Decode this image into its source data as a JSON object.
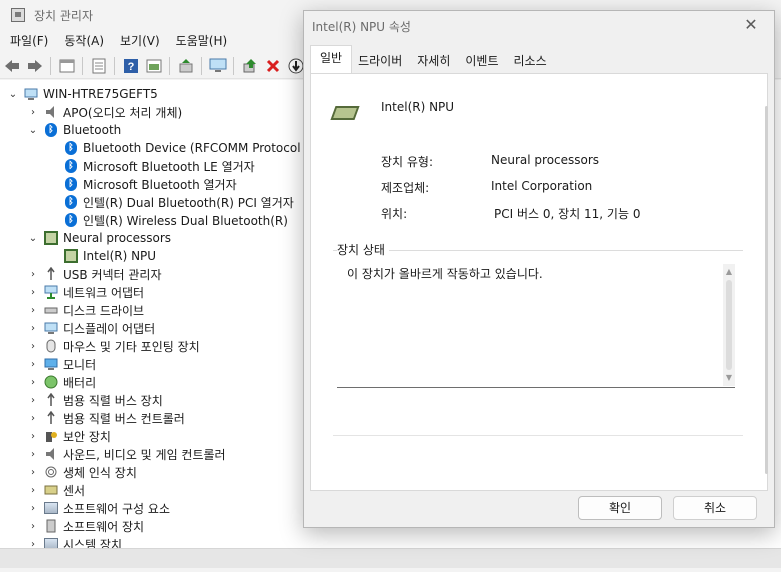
{
  "main_window": {
    "title": "장치 관리자",
    "menu": [
      "파일(F)",
      "동작(A)",
      "보기(V)",
      "도움말(H)"
    ],
    "toolbar_icons": [
      "back-icon",
      "forward-icon",
      "properties-icon",
      "list-icon",
      "help-icon",
      "console-icon",
      "update-driver-icon",
      "monitor-icon",
      "enable-device-icon",
      "uninstall-icon",
      "download-icon"
    ]
  },
  "tree": {
    "root": "WIN-HTRE75GEFT5",
    "nodes": [
      {
        "label": "APO(오디오 처리 개체)",
        "expanded": false
      },
      {
        "label": "Bluetooth",
        "expanded": true
      },
      {
        "label": "Bluetooth Device (RFCOMM Protocol TDI)",
        "child": true
      },
      {
        "label": "Microsoft Bluetooth LE 열거자",
        "child": true
      },
      {
        "label": "Microsoft Bluetooth 열거자",
        "child": true
      },
      {
        "label": "인텔(R) Dual Bluetooth(R) PCI 열거자",
        "child": true
      },
      {
        "label": "인텔(R) Wireless Dual Bluetooth(R)",
        "child": true
      },
      {
        "label": "Neural processors",
        "expanded": true
      },
      {
        "label": "Intel(R) NPU",
        "child": true
      },
      {
        "label": "USB 커넥터 관리자",
        "expanded": false
      },
      {
        "label": "네트워크 어댑터",
        "expanded": false
      },
      {
        "label": "디스크 드라이브",
        "expanded": false
      },
      {
        "label": "디스플레이 어댑터",
        "expanded": false
      },
      {
        "label": "마우스 및 기타 포인팅 장치",
        "expanded": false
      },
      {
        "label": "모니터",
        "expanded": false
      },
      {
        "label": "배터리",
        "expanded": false
      },
      {
        "label": "범용 직렬 버스 장치",
        "expanded": false
      },
      {
        "label": "범용 직렬 버스 컨트롤러",
        "expanded": false
      },
      {
        "label": "보안 장치",
        "expanded": false
      },
      {
        "label": "사운드, 비디오 및 게임 컨트롤러",
        "expanded": false
      },
      {
        "label": "생체 인식 장치",
        "expanded": false
      },
      {
        "label": "센서",
        "expanded": false
      },
      {
        "label": "소프트웨어 구성 요소",
        "expanded": false
      },
      {
        "label": "소프트웨어 장치",
        "expanded": false
      },
      {
        "label": "시스템 장치",
        "expanded": false
      }
    ]
  },
  "dialog": {
    "title": "Intel(R) NPU 속성",
    "tabs": [
      "일반",
      "드라이버",
      "자세히",
      "이벤트",
      "리소스"
    ],
    "active_tab": "일반",
    "device_name": "Intel(R) NPU",
    "properties": [
      {
        "label": "장치 유형:",
        "value": "Neural processors"
      },
      {
        "label": "제조업체:",
        "value": "Intel Corporation"
      },
      {
        "label": "위치:",
        "value": "PCI 버스 0, 장치 11, 기능 0"
      }
    ],
    "status_group_title": "장치 상태",
    "status_text": "이 장치가 올바르게 작동하고 있습니다.",
    "buttons": {
      "ok": "확인",
      "cancel": "취소"
    }
  }
}
